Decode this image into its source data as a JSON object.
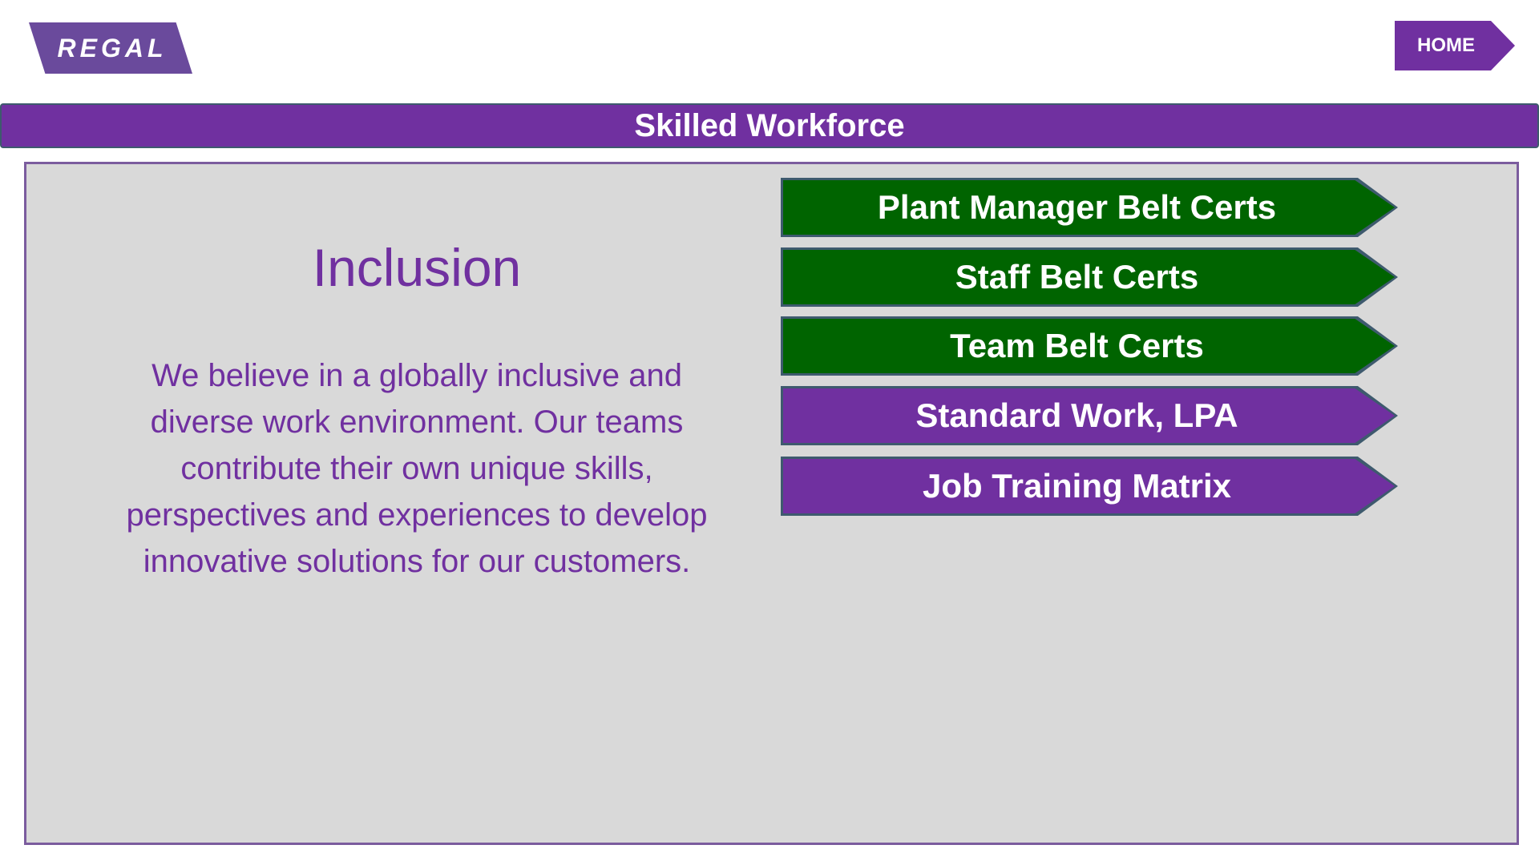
{
  "logo": {
    "text": "REGAL",
    "color": "#6a4a9c"
  },
  "header": {
    "home_label": "HOME",
    "title": "Skilled Workforce"
  },
  "content": {
    "heading": "Inclusion",
    "body": "We believe in a globally inclusive and diverse work environment. Our teams contribute their own unique skills, perspectives and experiences to develop innovative solutions for our customers."
  },
  "nav": {
    "buttons": [
      {
        "label": "Plant Manager Belt Certs",
        "color": "#006400"
      },
      {
        "label": "Staff Belt Certs",
        "color": "#006400"
      },
      {
        "label": "Team Belt Certs",
        "color": "#006400"
      },
      {
        "label": "Standard Work, LPA",
        "color": "#7030a0"
      },
      {
        "label": "Job Training Matrix",
        "color": "#7030a0"
      }
    ]
  },
  "colors": {
    "brand_purple": "#7030a0",
    "green": "#006400",
    "panel_bg": "#d9d9d9",
    "border": "#3e5a6e"
  }
}
